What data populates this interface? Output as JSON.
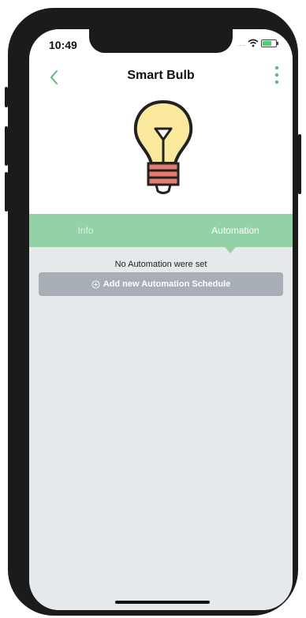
{
  "status_bar": {
    "time": "10:49",
    "signal_dots": "....",
    "icons": [
      "wifi-icon",
      "battery-icon"
    ]
  },
  "header": {
    "title": "Smart Bulb",
    "back_icon": "chevron-left-icon",
    "menu_icon": "kebab-menu-icon"
  },
  "device": {
    "icon": "light-bulb-icon"
  },
  "tabs": [
    {
      "label": "Info",
      "active": false
    },
    {
      "label": "Automation",
      "active": true
    }
  ],
  "automation": {
    "empty_message": "No Automation were set",
    "add_button_label": "Add new Automation Schedule",
    "add_icon": "plus-circle-icon"
  },
  "colors": {
    "accent": "#93d2a6",
    "content_bg": "#e5e9ec",
    "button_bg": "#a8aeb6",
    "bulb_yellow": "#fbe99d",
    "bulb_base": "#e57d6f"
  }
}
